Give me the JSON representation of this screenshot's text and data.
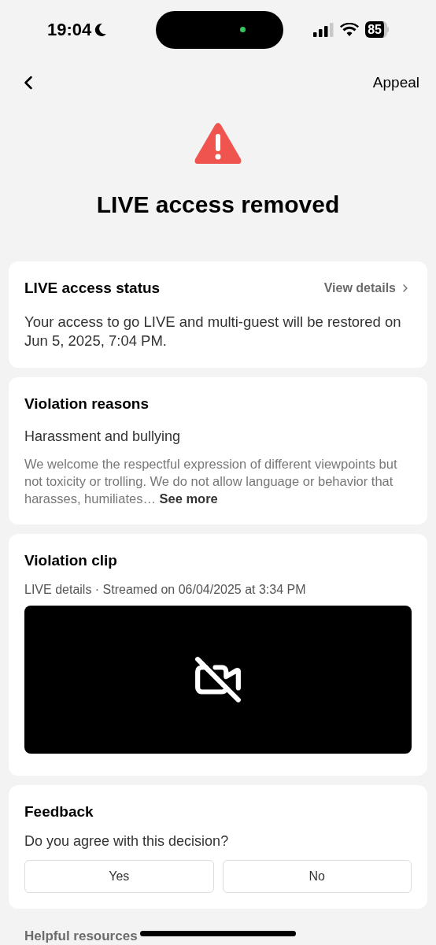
{
  "status_bar": {
    "time": "19:04",
    "battery": "85"
  },
  "nav": {
    "action": "Appeal"
  },
  "header": {
    "title": "LIVE access removed"
  },
  "access_status": {
    "title": "LIVE access status",
    "link": "View details",
    "text": "Your access to go LIVE and multi-guest will be restored on Jun 5, 2025, 7:04 PM."
  },
  "violation_reasons": {
    "title": "Violation reasons",
    "reason": "Harassment and bullying",
    "description": "We welcome the respectful expression of different viewpoints but not toxicity or trolling. We do not allow language or behavior that harasses, humiliates…",
    "more": "See more"
  },
  "violation_clip": {
    "title": "Violation clip",
    "meta": "LIVE details · Streamed on 06/04/2025 at 3:34 PM"
  },
  "feedback": {
    "title": "Feedback",
    "question": "Do you agree with this decision?",
    "buttons": [
      "Yes",
      "No"
    ]
  },
  "helpful_resources": {
    "title": "Helpful resources"
  }
}
